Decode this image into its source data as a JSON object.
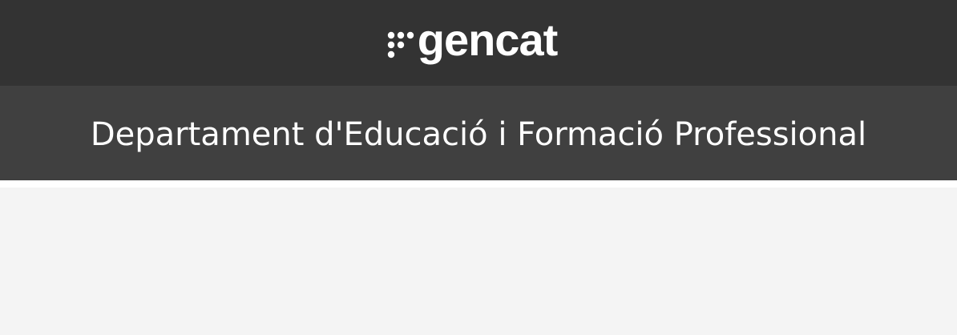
{
  "header": {
    "logo_text": "gencat",
    "logo_icon": "gencat-dots-icon",
    "background": "#333333"
  },
  "department": {
    "title": "Departament d'Educació i Formació Professional",
    "background": "#404040"
  },
  "content": {
    "background": "#f4f4f4"
  }
}
